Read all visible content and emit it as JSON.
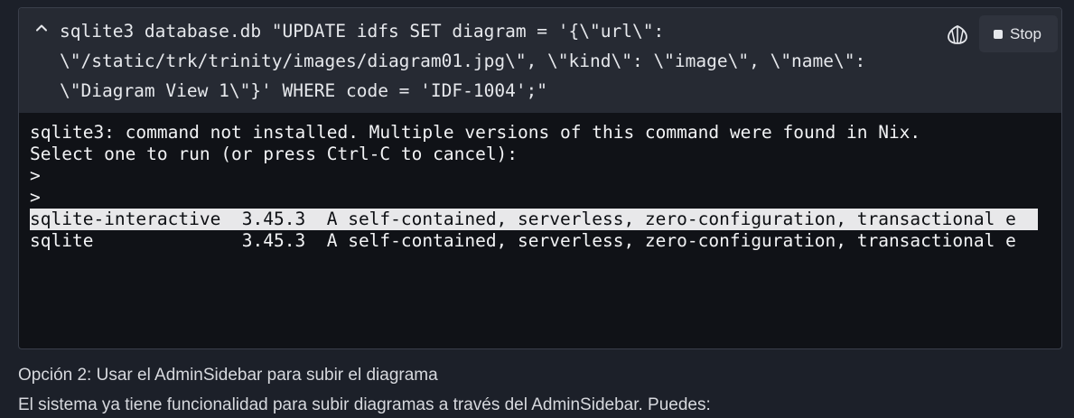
{
  "command": {
    "lines": [
      "sqlite3 database.db \"UPDATE idfs SET diagram = '{\\\"url\\\":",
      "\\\"/static/trk/trinity/images/diagram01.jpg\\\", \\\"kind\\\": \\\"image\\\", \\\"name\\\":",
      "\\\"Diagram View 1\\\"}' WHERE code = 'IDF-1004';\""
    ],
    "stop_label": "Stop"
  },
  "output": {
    "lines": [
      "sqlite3: command not installed. Multiple versions of this command were found in Nix.",
      "Select one to run (or press Ctrl-C to cancel):",
      ">",
      ">",
      "sqlite-interactive  3.45.3  A self-contained, serverless, zero-configuration, transactional e",
      "sqlite              3.45.3  A self-contained, serverless, zero-configuration, transactional e"
    ],
    "selected_index": 4
  },
  "message": {
    "para1": "Opción 2: Usar el AdminSidebar para subir el diagrama",
    "para2": "El sistema ya tiene funcionalidad para subir diagramas a través del AdminSidebar. Puedes:"
  },
  "colors": {
    "background": "#1c2029",
    "header": "#262a33",
    "terminal": "#101217",
    "selection": "#e8e8ea"
  }
}
